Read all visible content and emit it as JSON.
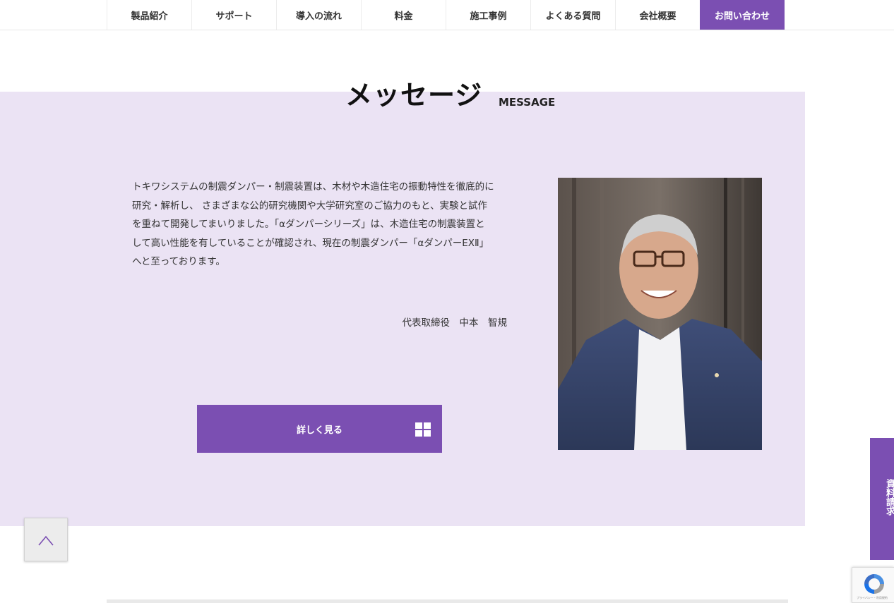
{
  "nav": {
    "items": [
      {
        "label": "製品紹介"
      },
      {
        "label": "サポート"
      },
      {
        "label": "導入の流れ"
      },
      {
        "label": "料金"
      },
      {
        "label": "施工事例"
      },
      {
        "label": "よくある質問"
      },
      {
        "label": "会社概要"
      }
    ],
    "contact_label": "お問い合わせ"
  },
  "message": {
    "title": "メッセージ",
    "subtitle": "MESSAGE",
    "lines": [
      "トキワシステムの制震ダンパー・制震装置は、木材や木造住宅の振動特性を徹底的に",
      "研究・解析し、 さまざまな公的研究機関や大学研究室のご協力のもと、実験と試作",
      "を重ねて開発してまいりました。「αダンパーシリーズ」は、木造住宅の制震装置と",
      "して高い性能を有していることが確認され、現在の制震ダンパー「αダンパーEXⅡ」",
      "へと至っております。"
    ],
    "signature": "代表取締役　中本　智規",
    "detail_button": "詳しく見る"
  },
  "side_tab": {
    "label": "資料請求"
  },
  "recaptcha": {
    "caption": "プライバシー・利用規約"
  },
  "colors": {
    "accent": "#7b4fb2",
    "band": "#ebe3f4"
  },
  "icons": {
    "page_top": "chevron-up-icon",
    "detail": "grid-icon",
    "recaptcha": "recaptcha-icon"
  }
}
